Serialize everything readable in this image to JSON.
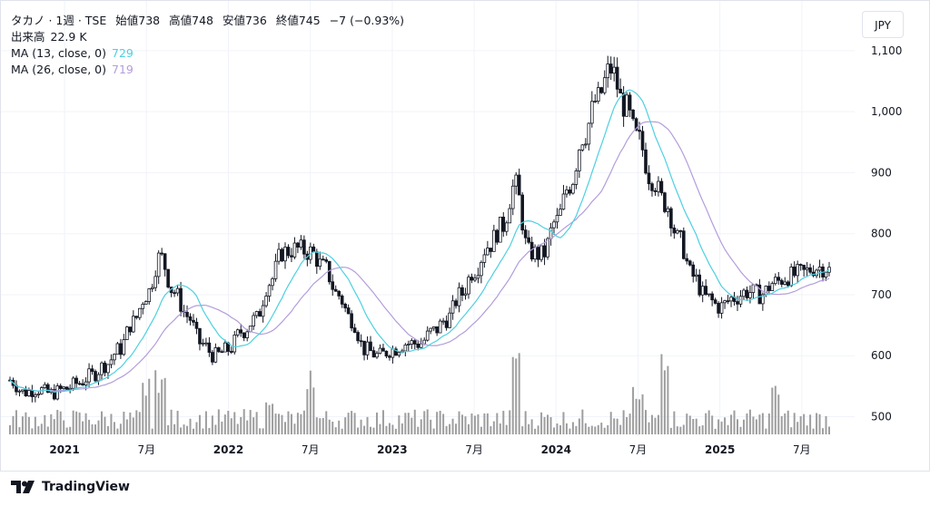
{
  "legend": {
    "symbol": "タカノ · 1週 · TSE",
    "open_label": "始値",
    "open": "738",
    "high_label": "高値",
    "high": "748",
    "low_label": "安値",
    "low": "736",
    "close_label": "終値",
    "close": "745",
    "change": "−7 (−0.93%)",
    "volume_label": "出来高",
    "volume": "22.9 K",
    "ma13_label": "MA (13, close, 0)",
    "ma13_value": "729",
    "ma26_label": "MA (26, close, 0)",
    "ma26_value": "719"
  },
  "currency": "JPY",
  "brand": {
    "name": "TradingView"
  },
  "colors": {
    "up": "#131722",
    "down": "#131722",
    "up_body": "#ffffff",
    "ma13": "#4dd0e1",
    "ma26": "#b39ddb",
    "volume": "#9e9e9e",
    "grid": "#f0f3fa",
    "axis_text": "#131722"
  },
  "chart_data": {
    "type": "candlestick",
    "title": "",
    "xlabel": "",
    "ylabel": "",
    "ylim": [
      470,
      1110
    ],
    "y_ticks": [
      500,
      600,
      700,
      800,
      900,
      "1,000",
      "1,100"
    ],
    "x_ticks": [
      {
        "label": "2021",
        "date": "2021-01"
      },
      {
        "label": "7月",
        "date": "2021-07"
      },
      {
        "label": "2022",
        "date": "2022-01"
      },
      {
        "label": "7月",
        "date": "2022-07"
      },
      {
        "label": "2023",
        "date": "2023-01"
      },
      {
        "label": "7月",
        "date": "2023-07"
      },
      {
        "label": "2024",
        "date": "2024-01"
      },
      {
        "label": "7月",
        "date": "2024-07"
      },
      {
        "label": "2025",
        "date": "2025-01"
      },
      {
        "label": "7月",
        "date": "2025-07"
      }
    ],
    "price_points": [
      [
        "2020-09",
        560
      ],
      [
        "2020-10",
        540
      ],
      [
        "2020-11",
        545
      ],
      [
        "2020-12",
        538
      ],
      [
        "2021-01",
        545
      ],
      [
        "2021-02",
        555
      ],
      [
        "2021-03",
        568
      ],
      [
        "2021-04",
        585
      ],
      [
        "2021-05",
        610
      ],
      [
        "2021-06",
        655
      ],
      [
        "2021-07",
        700
      ],
      [
        "2021-08",
        762
      ],
      [
        "2021-09",
        705
      ],
      [
        "2021-10",
        665
      ],
      [
        "2021-11",
        620
      ],
      [
        "2021-12",
        600
      ],
      [
        "2022-01",
        610
      ],
      [
        "2022-02",
        640
      ],
      [
        "2022-03",
        660
      ],
      [
        "2022-04",
        720
      ],
      [
        "2022-05",
        770
      ],
      [
        "2022-06",
        775
      ],
      [
        "2022-07",
        770
      ],
      [
        "2022-08",
        745
      ],
      [
        "2022-09",
        700
      ],
      [
        "2022-10",
        660
      ],
      [
        "2022-11",
        610
      ],
      [
        "2022-12",
        600
      ],
      [
        "2023-01",
        610
      ],
      [
        "2023-02",
        620
      ],
      [
        "2023-03",
        620
      ],
      [
        "2023-04",
        640
      ],
      [
        "2023-05",
        660
      ],
      [
        "2023-06",
        700
      ],
      [
        "2023-07",
        740
      ],
      [
        "2023-08",
        780
      ],
      [
        "2023-09",
        810
      ],
      [
        "2023-10",
        880
      ],
      [
        "2023-11",
        770
      ],
      [
        "2023-12",
        765
      ],
      [
        "2024-01",
        820
      ],
      [
        "2024-02",
        880
      ],
      [
        "2024-03",
        960
      ],
      [
        "2024-04",
        1020
      ],
      [
        "2024-05",
        1070
      ],
      [
        "2024-06",
        1010
      ],
      [
        "2024-07",
        955
      ],
      [
        "2024-08",
        890
      ],
      [
        "2024-09",
        850
      ],
      [
        "2024-10",
        790
      ],
      [
        "2024-11",
        730
      ],
      [
        "2024-12",
        695
      ],
      [
        "2025-01",
        680
      ],
      [
        "2025-02",
        695
      ],
      [
        "2025-03",
        705
      ],
      [
        "2025-04",
        700
      ],
      [
        "2025-05",
        720
      ],
      [
        "2025-06",
        730
      ],
      [
        "2025-07",
        735
      ],
      [
        "2025-08",
        745
      ]
    ],
    "volume_peaks": [
      [
        "2021-07",
        0.55
      ],
      [
        "2021-08",
        0.65
      ],
      [
        "2022-04",
        0.45
      ],
      [
        "2022-07",
        0.7
      ],
      [
        "2023-10",
        1.0
      ],
      [
        "2024-07",
        0.5
      ],
      [
        "2024-09",
        1.0
      ],
      [
        "2025-05",
        0.5
      ]
    ],
    "ma13_last": 729,
    "ma26_last": 719,
    "last_close": 745
  }
}
